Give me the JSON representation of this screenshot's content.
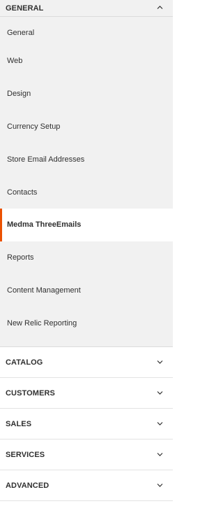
{
  "general": {
    "title": "GENERAL",
    "items": [
      "General",
      "Web",
      "Design",
      "Currency Setup",
      "Store Email Addresses",
      "Contacts",
      "Medma ThreeEmails",
      "Reports",
      "Content Management",
      "New Relic Reporting"
    ],
    "active_item": "Medma ThreeEmails",
    "state": "expanded"
  },
  "sections": [
    {
      "title": "CATALOG",
      "state": "collapsed"
    },
    {
      "title": "CUSTOMERS",
      "state": "collapsed"
    },
    {
      "title": "SALES",
      "state": "collapsed"
    },
    {
      "title": "SERVICES",
      "state": "collapsed"
    },
    {
      "title": "ADVANCED",
      "state": "collapsed"
    }
  ],
  "colors": {
    "accent": "#eb5202",
    "background": "#f1f1f1",
    "text": "#303030"
  }
}
